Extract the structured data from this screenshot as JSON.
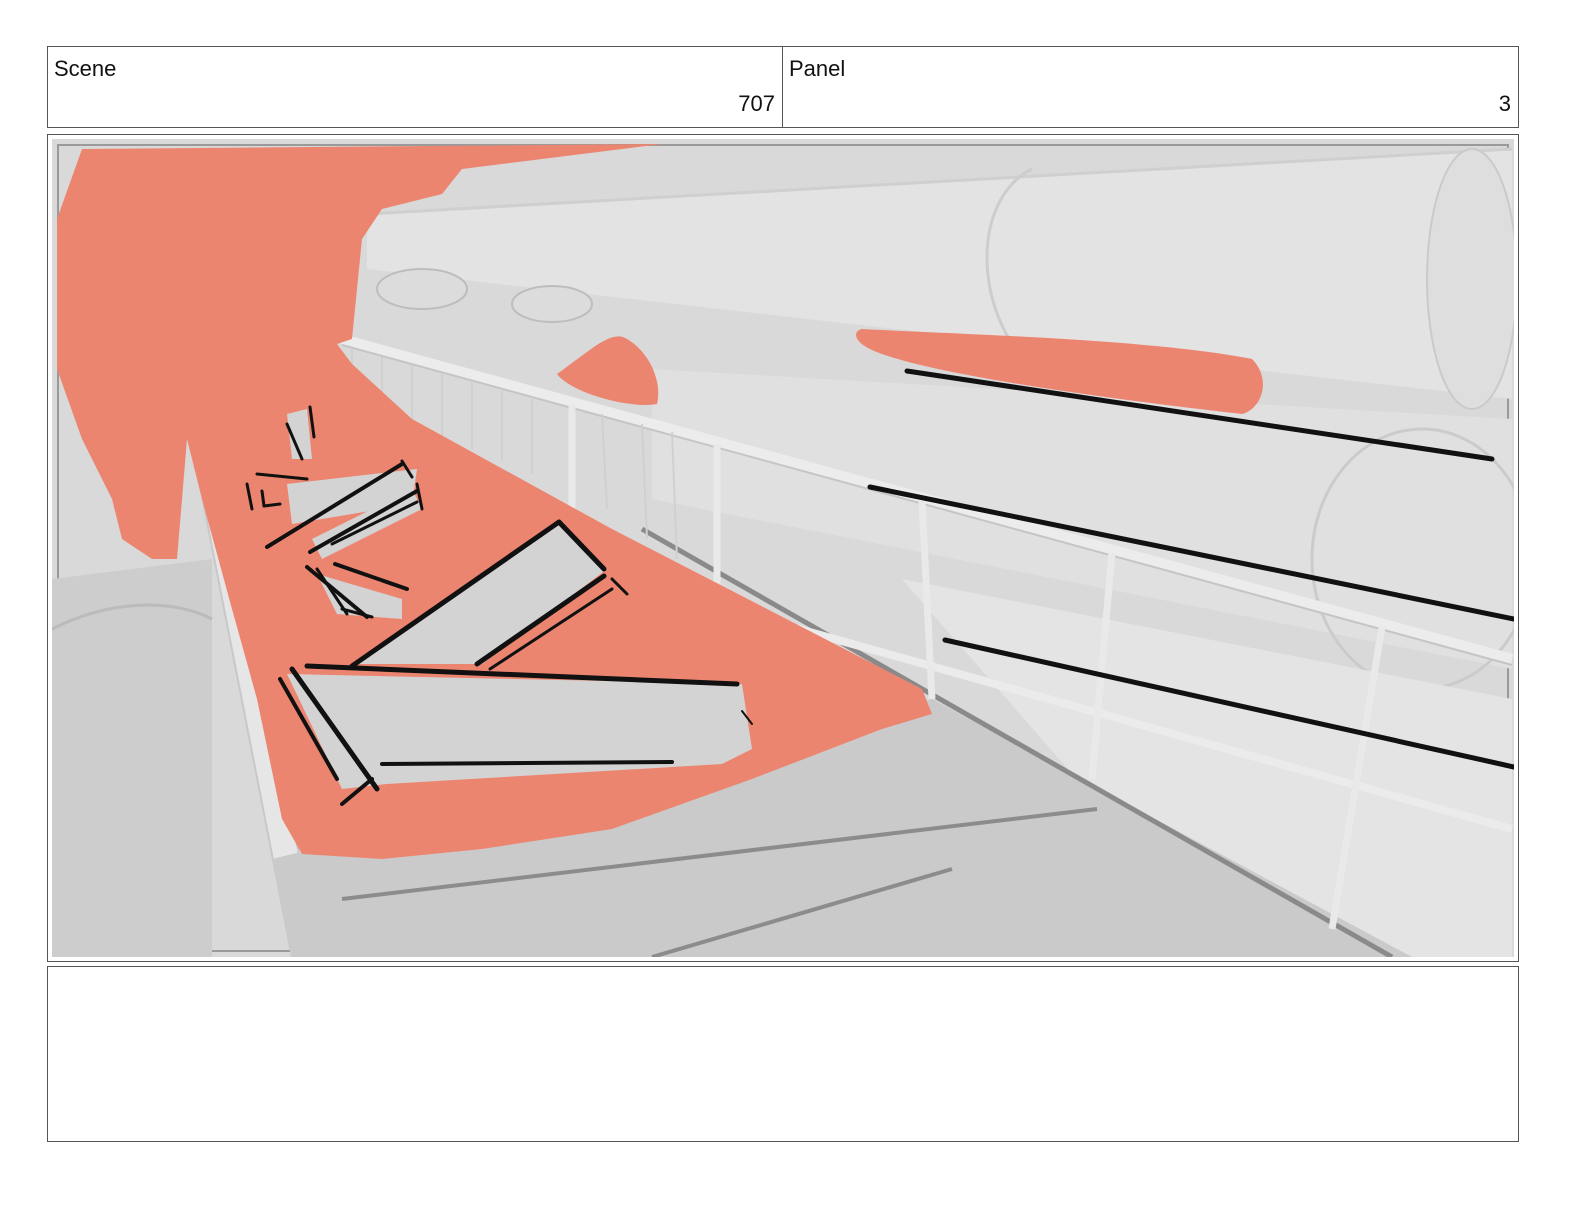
{
  "header": {
    "scene_label": "Scene",
    "scene_number": "707",
    "panel_label": "Panel",
    "panel_number": "3"
  },
  "artwork": {
    "background_color": "#d9d9d9",
    "highlight_color": "#ec8570",
    "line_color": "#111111"
  },
  "notes": {
    "text": ""
  }
}
